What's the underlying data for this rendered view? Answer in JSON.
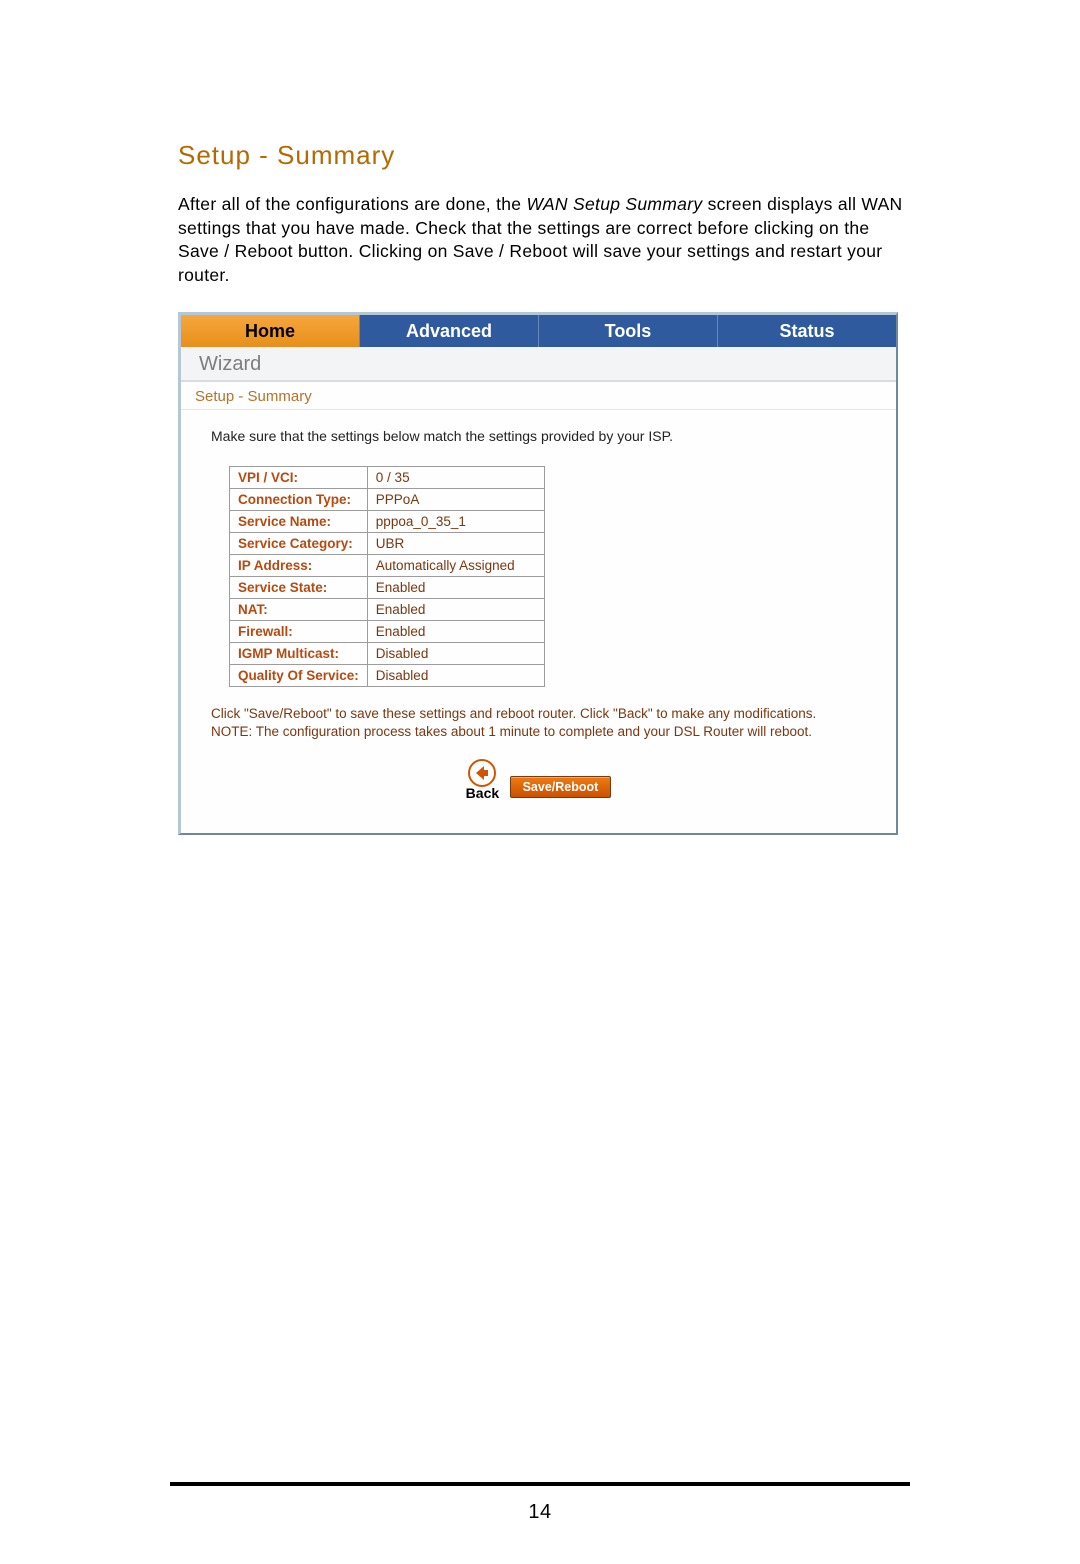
{
  "doc": {
    "section_title": "Setup - Summary",
    "paragraph_pre": "After all of the configurations are done, the ",
    "paragraph_em": "WAN Setup Summary",
    "paragraph_post": " screen displays all WAN settings that you have made.  Check that the settings are correct before clicking on the Save / Reboot button.  Clicking on Save / Reboot will save your settings and restart your router.",
    "page_number": "14"
  },
  "router": {
    "tabs": {
      "home": "Home",
      "advanced": "Advanced",
      "tools": "Tools",
      "status": "Status"
    },
    "subnav": "Wizard",
    "breadcrumb": "Setup - Summary",
    "instruction": "Make sure that the settings below match the settings provided by your ISP.",
    "settings": [
      {
        "label": "VPI / VCI:",
        "value": "0 / 35"
      },
      {
        "label": "Connection Type:",
        "value": "PPPoA"
      },
      {
        "label": "Service Name:",
        "value": "pppoa_0_35_1"
      },
      {
        "label": "Service Category:",
        "value": "UBR"
      },
      {
        "label": "IP Address:",
        "value": "Automatically Assigned"
      },
      {
        "label": "Service State:",
        "value": "Enabled"
      },
      {
        "label": "NAT:",
        "value": "Enabled"
      },
      {
        "label": "Firewall:",
        "value": "Enabled"
      },
      {
        "label": "IGMP Multicast:",
        "value": "Disabled"
      },
      {
        "label": "Quality Of Service:",
        "value": "Disabled"
      }
    ],
    "footer_line1": "Click \"Save/Reboot\" to save these settings and reboot router. Click \"Back\" to make any modifications.",
    "footer_line2": "NOTE: The configuration process takes about 1 minute to complete and your DSL Router will reboot.",
    "buttons": {
      "back": "Back",
      "save": "Save/Reboot"
    }
  }
}
